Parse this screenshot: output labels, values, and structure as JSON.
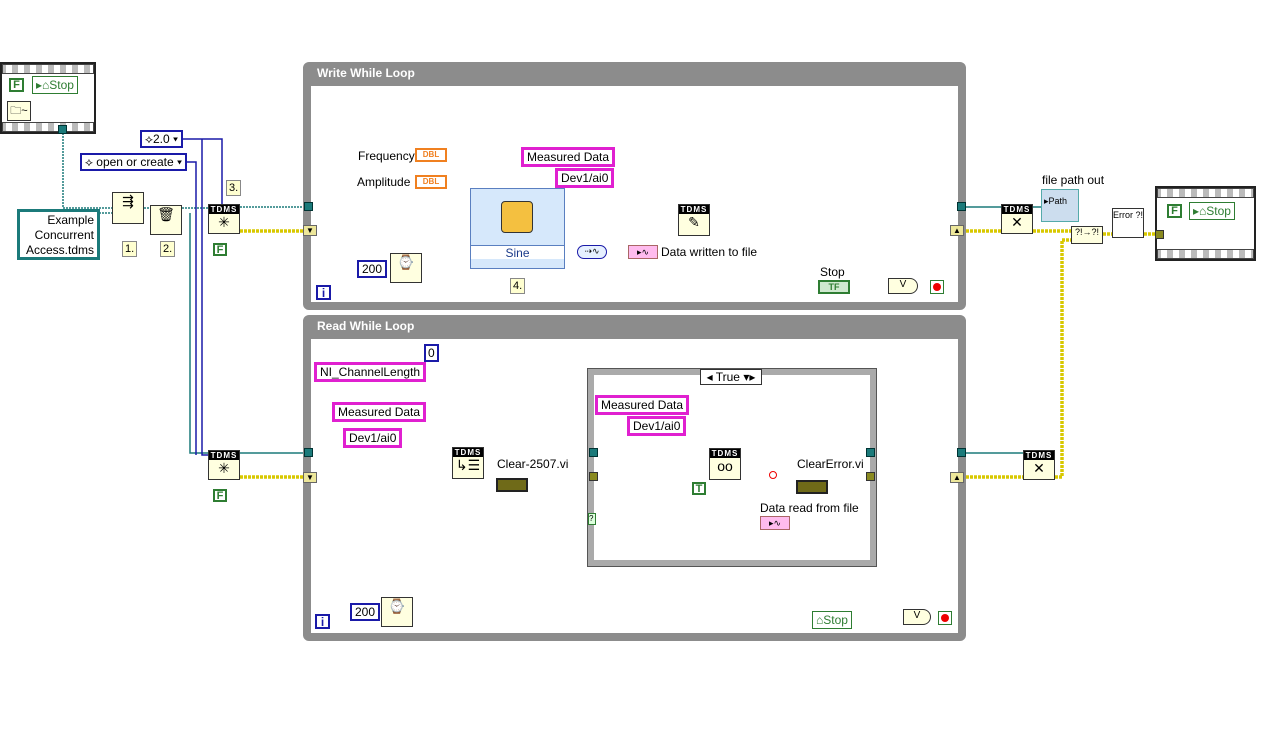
{
  "left_sequence": {
    "false_constant": "F",
    "stop_local": "Stop",
    "file_icon": "file-waveform-icon"
  },
  "constants": {
    "version": "2.0",
    "operation": "open or create",
    "file_path": "Example Concurrent Access.tdms",
    "open_false": "F",
    "read_true": "T",
    "write_wait_ms": "200",
    "read_wait_ms": "200",
    "offset": "0"
  },
  "step_labels": {
    "s1": "1.",
    "s2": "2.",
    "s3": "3.",
    "s4": "4."
  },
  "write_loop": {
    "title": "Write While Loop",
    "frequency_label": "Frequency",
    "amplitude_label": "Amplitude",
    "dbl": "DBL",
    "express_vi_mode": "Sine",
    "group_name": "Measured Data",
    "channel_name": "Dev1/ai0",
    "tdms_header": "TDMS",
    "indicator_label": "Data written to file",
    "stop_label": "Stop",
    "stop_control": "TF",
    "iteration": "i"
  },
  "read_loop": {
    "title": "Read While Loop",
    "property_name": "NI_ChannelLength",
    "group_name": "Measured Data",
    "channel_name": "Dev1/ai0",
    "clear_vi_label": "Clear-2507.vi",
    "case_selector": "True",
    "case_group_name": "Measured Data",
    "case_channel_name": "Dev1/ai0",
    "clear_error_label": "ClearError.vi",
    "indicator_label": "Data read from file",
    "stop_local": "Stop",
    "iteration": "i",
    "tdms_header": "TDMS"
  },
  "right_side": {
    "file_path_out_label": "file path out",
    "path_indicator": "Path",
    "error_icon": "Error ?!",
    "stop_false": "F",
    "stop_local": "Stop",
    "tdms_header": "TDMS"
  },
  "colors": {
    "loop_border": "#8c8c8c",
    "refnum_wire": "#1b7a7a",
    "error_wire": "#d8c800",
    "string_wire": "#e020d0",
    "numeric_wire": "#1a1aa8",
    "dbl_wire": "#f08020",
    "waveform_wire": "#8b2a10"
  }
}
